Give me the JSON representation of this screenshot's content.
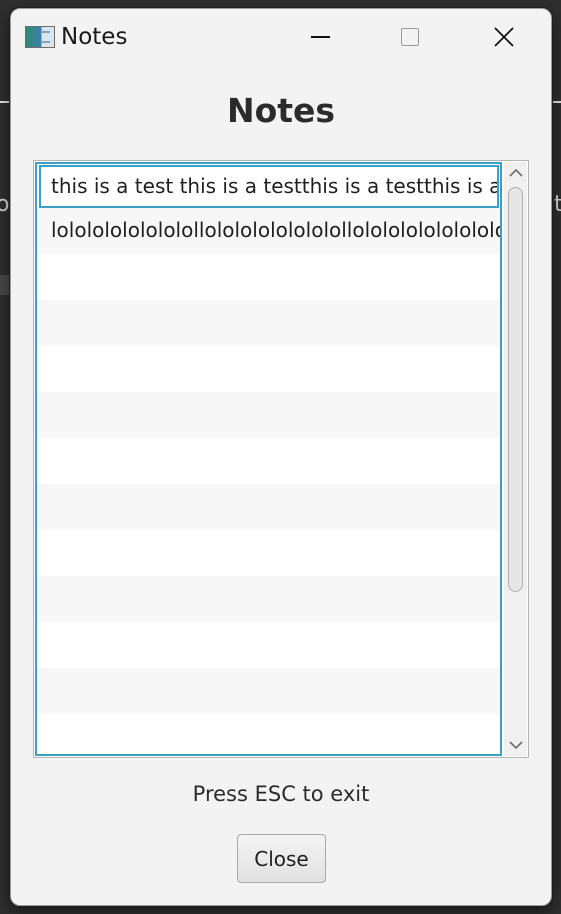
{
  "window": {
    "title": "Notes",
    "icon": "notes-app-icon"
  },
  "title_controls": {
    "minimize_icon": "minimize-icon",
    "maximize_icon": "maximize-icon",
    "close_glyph": "✕"
  },
  "dialog": {
    "heading": "Notes",
    "hint": "Press ESC to exit",
    "close_label": "Close"
  },
  "notes": [
    "this is a test this is a testthis is a testthis is a test",
    "lolololololololollolololololololollololololololololo"
  ],
  "scrollbar": {
    "up_glyph": "︿",
    "down_glyph": "﹀"
  },
  "colors": {
    "focus_accent": "#3b9fc6",
    "dialog_bg": "#f3f3f3"
  }
}
